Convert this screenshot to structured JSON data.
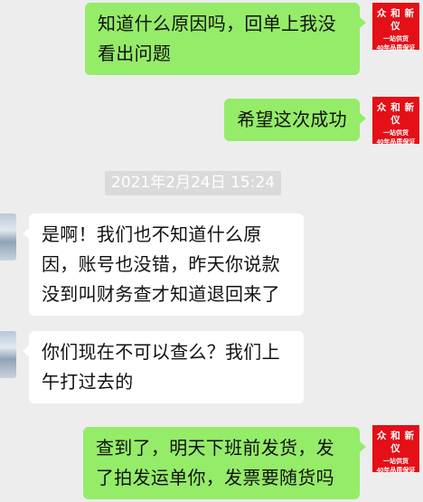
{
  "messages": [
    {
      "sender": "me",
      "text": "知道什么原因吗，回单上我没看出问题"
    },
    {
      "sender": "me",
      "text": "希望这次成功"
    },
    {
      "sender": "them",
      "text": "是啊！我们也不知道什么原因，账号也没错，昨天你说款没到叫财务查才知道退回来了"
    },
    {
      "sender": "them",
      "text": "你们现在不可以查么？我们上午打过去的"
    },
    {
      "sender": "me",
      "text": "查到了，明天下班前发货，发了拍发运单你，发票要随货吗"
    }
  ],
  "timestamp": "2021年2月24日 15:24",
  "brand_avatar": {
    "line1": "众 和 新 仪",
    "line2": "一站供货",
    "line3": "40年品质保证"
  },
  "colors": {
    "background": "#ededed",
    "my_bubble": "#95ec69",
    "their_bubble": "#ffffff",
    "brand_red": "#e40f17"
  }
}
